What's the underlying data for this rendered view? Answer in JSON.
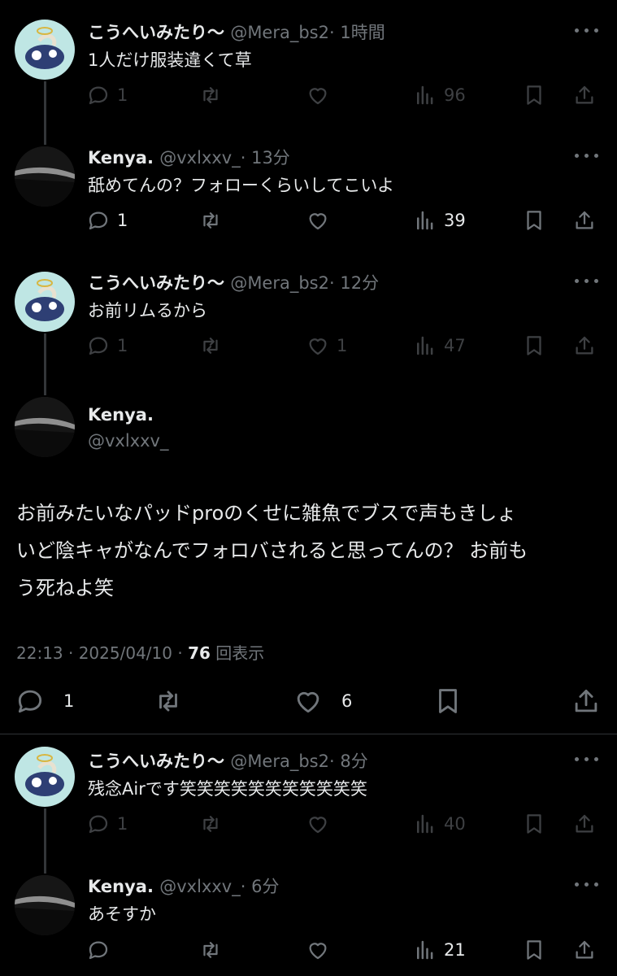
{
  "tweets": [
    {
      "name": "こうへいみたり〜",
      "handle": "@Mera_bs2",
      "time": "· 1時間",
      "text": "1人だけ服装違くて草",
      "replies": "1",
      "likes": "",
      "views": "96"
    },
    {
      "name": "Kenya.",
      "handle": "@vxlxxv_",
      "time": "· 13分",
      "text": "舐めてんの？フォローくらいしてこいよ",
      "replies": "1",
      "likes": "",
      "views": "39"
    },
    {
      "name": "こうへいみたり〜",
      "handle": "@Mera_bs2",
      "time": "· 12分",
      "text": "お前リムるから",
      "replies": "1",
      "likes": "1",
      "views": "47"
    },
    {
      "name": "こうへいみたり〜",
      "handle": "@Mera_bs2",
      "time": "· 8分",
      "text": "残念Airです笑笑笑笑笑笑笑笑笑笑笑",
      "replies": "1",
      "likes": "",
      "views": "40"
    },
    {
      "name": "Kenya.",
      "handle": "@vxlxxv_",
      "time": "· 6分",
      "text": "あそすか",
      "replies": "",
      "likes": "",
      "views": "21"
    }
  ],
  "focused": {
    "name": "Kenya.",
    "handle": "@vxlxxv_",
    "lines": [
      "お前みたいなパッドproのくせに雑魚でブスで声もきしょ",
      "いど陰キャがなんでフォロバされると思ってんの？ お前も",
      "う死ねよ笑"
    ],
    "timestamp": "22:13 · 2025/04/10 · ",
    "views": "76",
    "views_label": "回表示",
    "replies": "1",
    "likes": "6"
  }
}
